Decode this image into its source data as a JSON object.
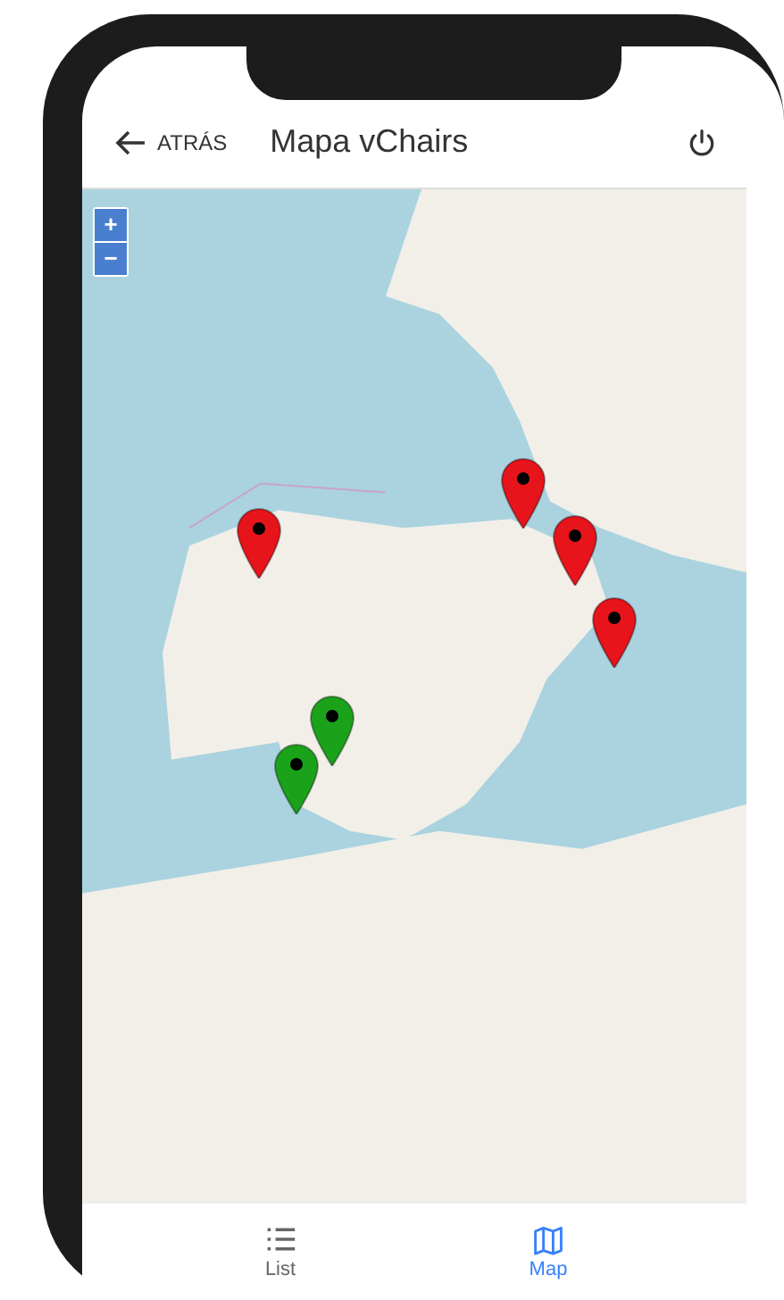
{
  "header": {
    "back_label": "ATRÁS",
    "title": "Mapa vChairs"
  },
  "map": {
    "zoom_in": "+",
    "zoom_out": "−",
    "markers": [
      {
        "color": "#e8141b"
      },
      {
        "color": "#e8141b"
      },
      {
        "color": "#e8141b"
      },
      {
        "color": "#e8141b"
      },
      {
        "color": "#1aa31a"
      },
      {
        "color": "#1aa31a"
      }
    ]
  },
  "tabs": [
    {
      "label": "List",
      "kind": "list",
      "selected": false
    },
    {
      "label": "Map",
      "kind": "map",
      "selected": true
    }
  ]
}
